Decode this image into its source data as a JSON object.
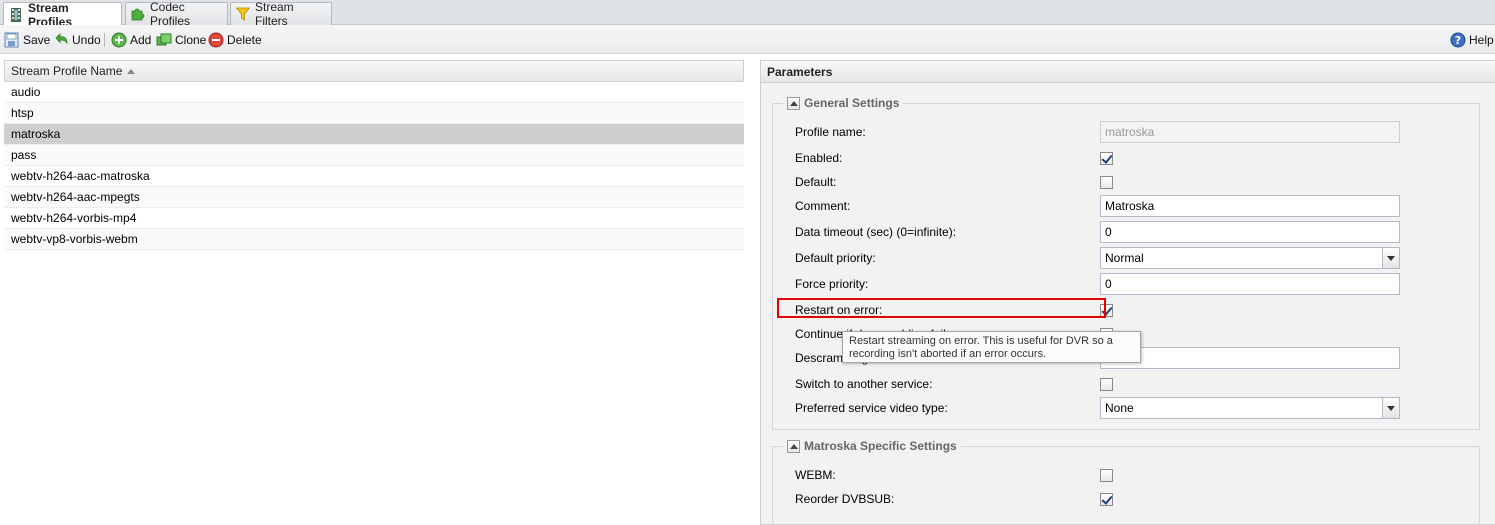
{
  "tabs": [
    {
      "label": "Stream Profiles",
      "icon": "film-icon"
    },
    {
      "label": "Codec Profiles",
      "icon": "puzzle-icon"
    },
    {
      "label": "Stream Filters",
      "icon": "funnel-icon"
    }
  ],
  "toolbar": {
    "save": "Save",
    "undo": "Undo",
    "add": "Add",
    "clone": "Clone",
    "delete": "Delete",
    "help": "Help"
  },
  "grid": {
    "column": "Stream Profile Name",
    "rows": [
      "audio",
      "htsp",
      "matroska",
      "pass",
      "webtv-h264-aac-matroska",
      "webtv-h264-aac-mpegts",
      "webtv-h264-vorbis-mp4",
      "webtv-vp8-vorbis-webm"
    ],
    "selected": "matroska"
  },
  "panel": {
    "title": "Parameters",
    "general": {
      "legend": "General Settings",
      "profile_name_label": "Profile name:",
      "profile_name_value": "matroska",
      "enabled_label": "Enabled:",
      "enabled": true,
      "default_label": "Default:",
      "default": false,
      "comment_label": "Comment:",
      "comment_value": "Matroska",
      "timeout_label": "Data timeout (sec) (0=infinite):",
      "timeout_value": "0",
      "priority_label": "Default priority:",
      "priority_value": "Normal",
      "force_priority_label": "Force priority:",
      "force_priority_value": "0",
      "restart_label": "Restart on error:",
      "restart": true,
      "continue_label": "Continue if descrambling fails:",
      "continue": true,
      "descrambling_label": "Descrambling timeout",
      "switch_label": "Switch to another service:",
      "switch": false,
      "video_type_label": "Preferred service video type:",
      "video_type_value": "None"
    },
    "matroska": {
      "legend": "Matroska Specific Settings",
      "webm_label": "WEBM:",
      "webm": false,
      "dvbsub_label": "Reorder DVBSUB:",
      "dvbsub": true
    },
    "tooltip": "Restart streaming on error. This is useful for DVR so a recording isn't aborted if an error occurs."
  },
  "colors": {
    "highlight": "#e00000",
    "selected_row": "#cfcfcf",
    "panel_bg": "#f2f2f2"
  }
}
